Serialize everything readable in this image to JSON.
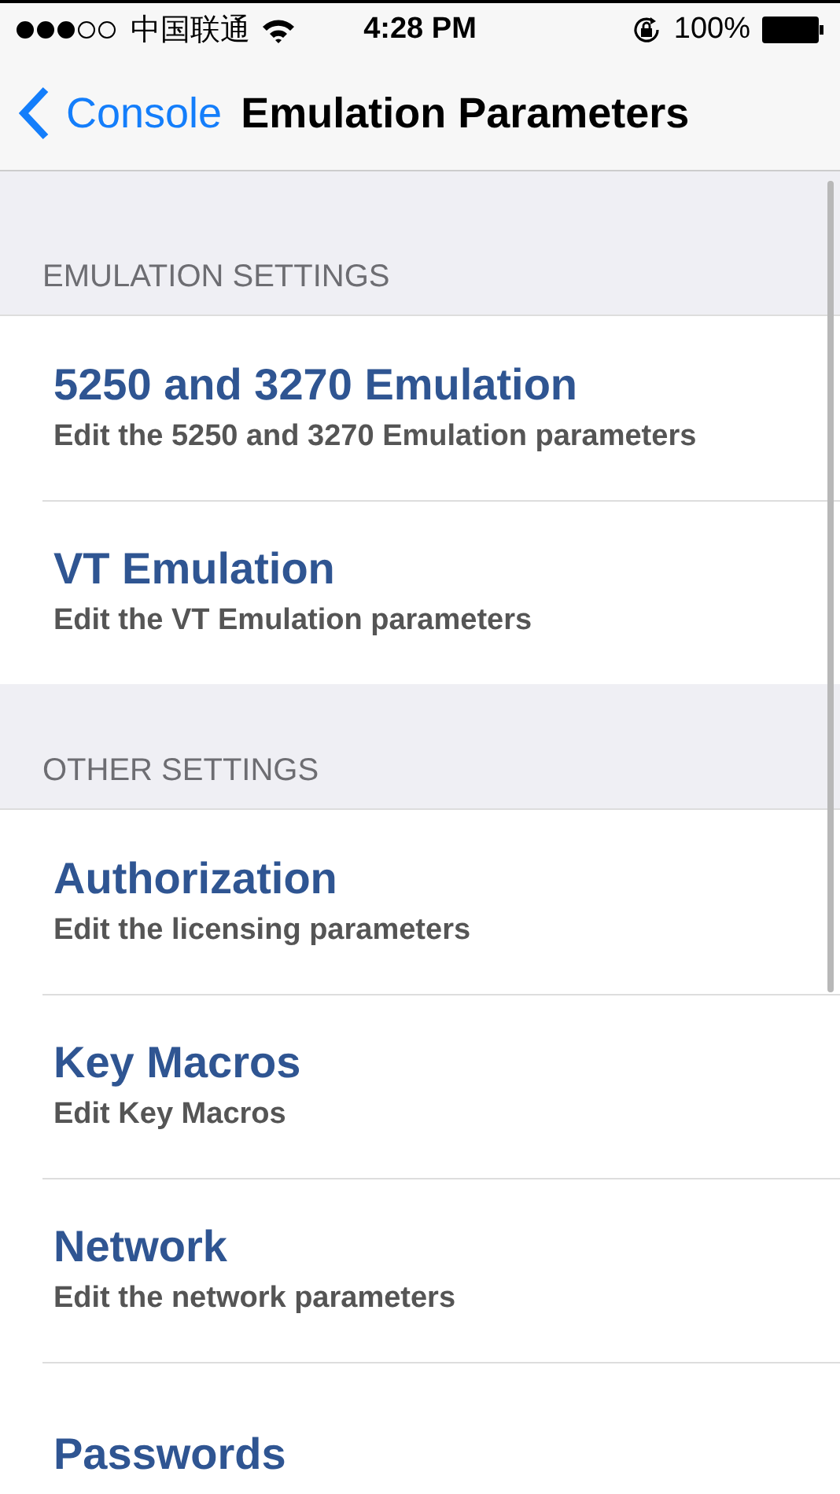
{
  "status_bar": {
    "carrier": "中国联通",
    "time": "4:28 PM",
    "battery": "100%"
  },
  "nav": {
    "back": "Console",
    "title": "Emulation Parameters"
  },
  "sections": [
    {
      "header": "EMULATION SETTINGS",
      "items": [
        {
          "title": "5250 and 3270 Emulation",
          "subtitle": "Edit the 5250 and 3270 Emulation parameters"
        },
        {
          "title": "VT Emulation",
          "subtitle": "Edit the VT Emulation parameters"
        }
      ]
    },
    {
      "header": "OTHER SETTINGS",
      "items": [
        {
          "title": "Authorization",
          "subtitle": "Edit the licensing parameters"
        },
        {
          "title": "Key Macros",
          "subtitle": "Edit Key Macros"
        },
        {
          "title": "Network",
          "subtitle": "Edit the network parameters"
        },
        {
          "title": "Passwords"
        }
      ]
    }
  ]
}
